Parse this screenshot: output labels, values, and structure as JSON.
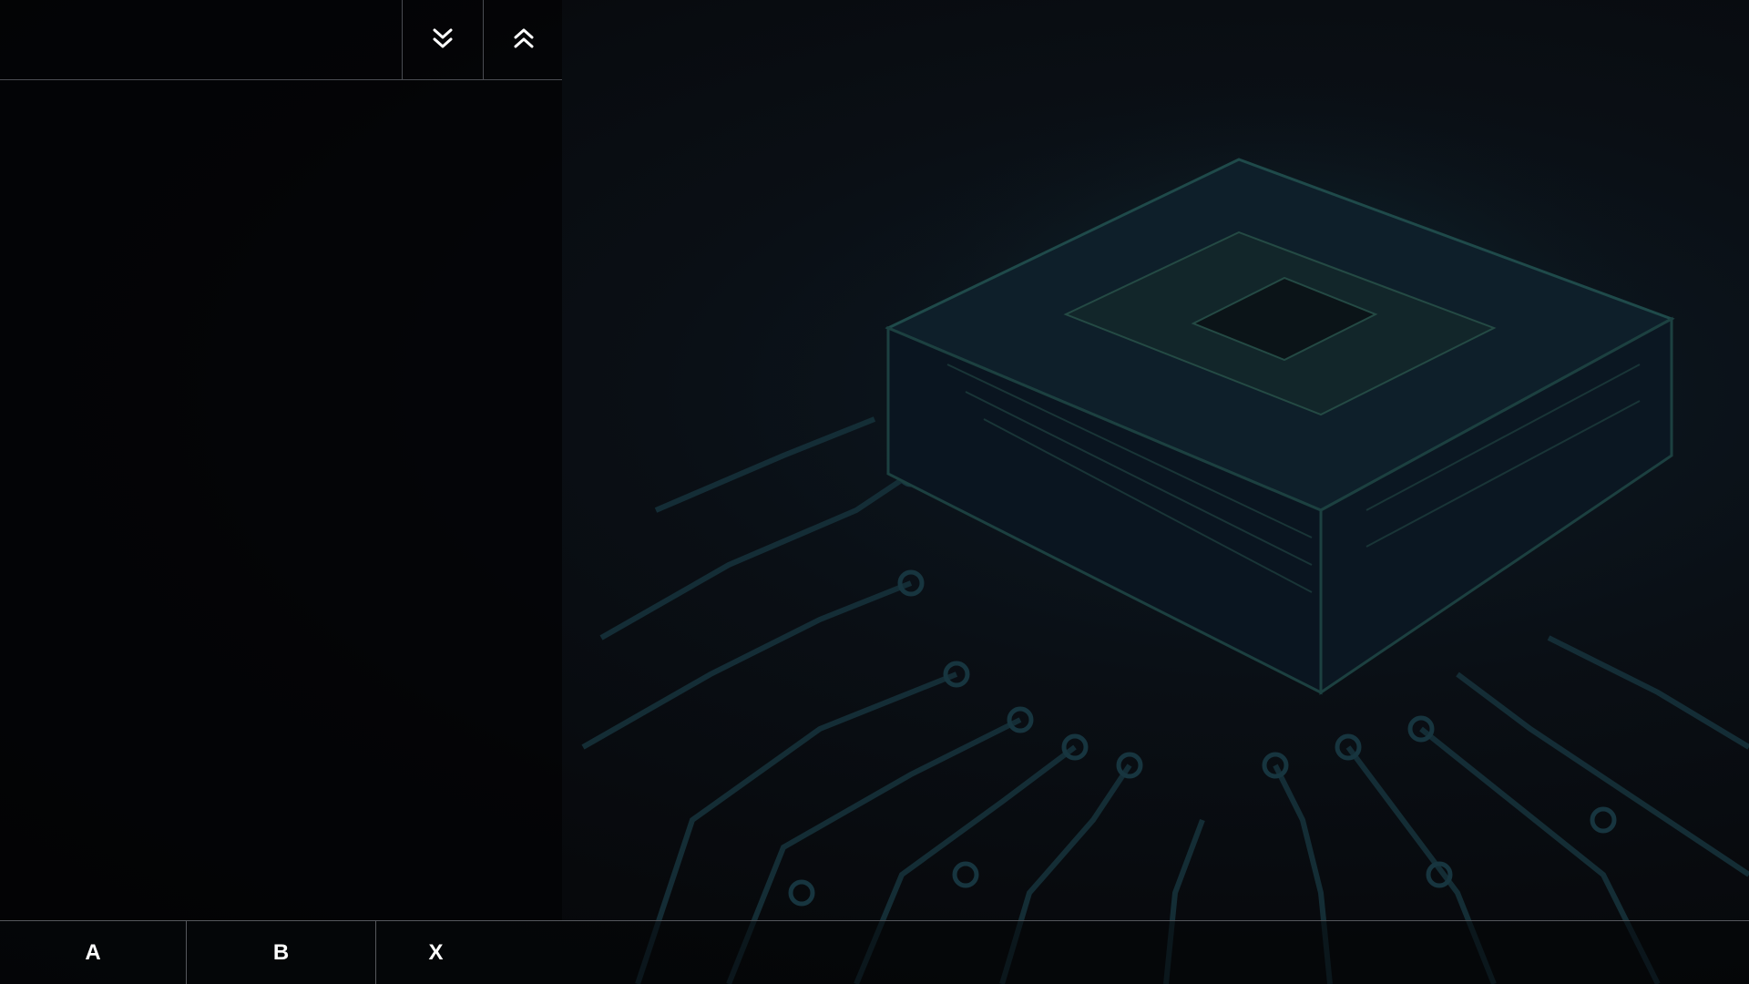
{
  "header": {
    "title": "",
    "scroll_down_icon": "chevron-double-down-icon",
    "scroll_up_icon": "chevron-double-up-icon"
  },
  "footer": {
    "keys": [
      {
        "label": "A"
      },
      {
        "label": "B"
      },
      {
        "label": "X"
      }
    ]
  },
  "colors": {
    "background": "#07090c",
    "divider": "#4a4c52",
    "circuit": "#1a3a44",
    "chip_glow": "#1f4a4a",
    "text": "#ffffff"
  }
}
